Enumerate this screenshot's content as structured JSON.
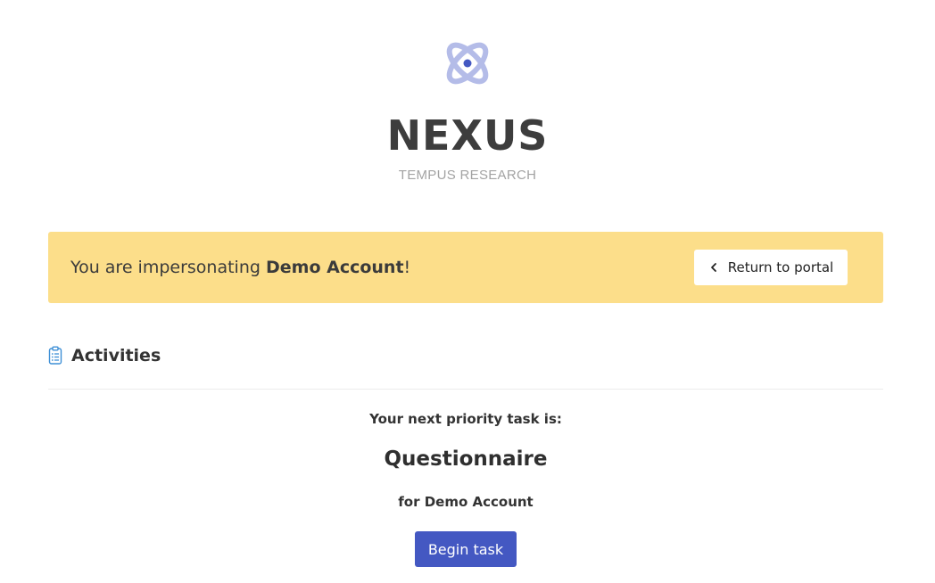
{
  "brand": {
    "logo_icon": "atom-icon",
    "name": "NEXUS",
    "subtitle": "TEMPUS RESEARCH"
  },
  "impersonation_banner": {
    "prefix": "You are impersonating ",
    "account_name": "Demo Account",
    "suffix": "!",
    "return_button_label": "Return to portal",
    "return_button_icon": "chevron-left-icon",
    "background_color": "#fcde8a"
  },
  "activities": {
    "icon": "clipboard-list-icon",
    "title": "Activities",
    "intro": "Your next priority task is:",
    "task_name": "Questionnaire",
    "task_for": "for Demo Account",
    "begin_button_label": "Begin task",
    "accent_color": "#4458c2"
  }
}
